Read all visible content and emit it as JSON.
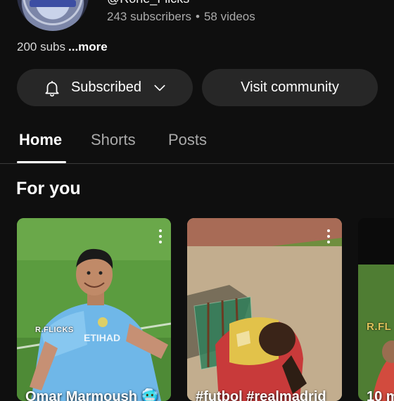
{
  "channel": {
    "handle": "@Rone_Flicks",
    "subscribers": "243 subscribers",
    "separator": "•",
    "videos": "58 videos",
    "description": "200 subs",
    "more_label": "...more"
  },
  "actions": {
    "subscribed_label": "Subscribed",
    "community_label": "Visit community"
  },
  "tabs": [
    {
      "label": "Home",
      "active": true
    },
    {
      "label": "Shorts",
      "active": false
    },
    {
      "label": "Posts",
      "active": false
    }
  ],
  "section": {
    "title": "For you"
  },
  "cards": [
    {
      "title": "Omar Marmoush 🥶",
      "watermark": "R.FLICKS"
    },
    {
      "title": "#futbol #realmadrid",
      "watermark": ""
    },
    {
      "title": "10 m",
      "watermark": "R.FL"
    }
  ],
  "colors": {
    "background": "#0f0f0f",
    "pill": "#272727",
    "muted_text": "#aaaaaa"
  }
}
